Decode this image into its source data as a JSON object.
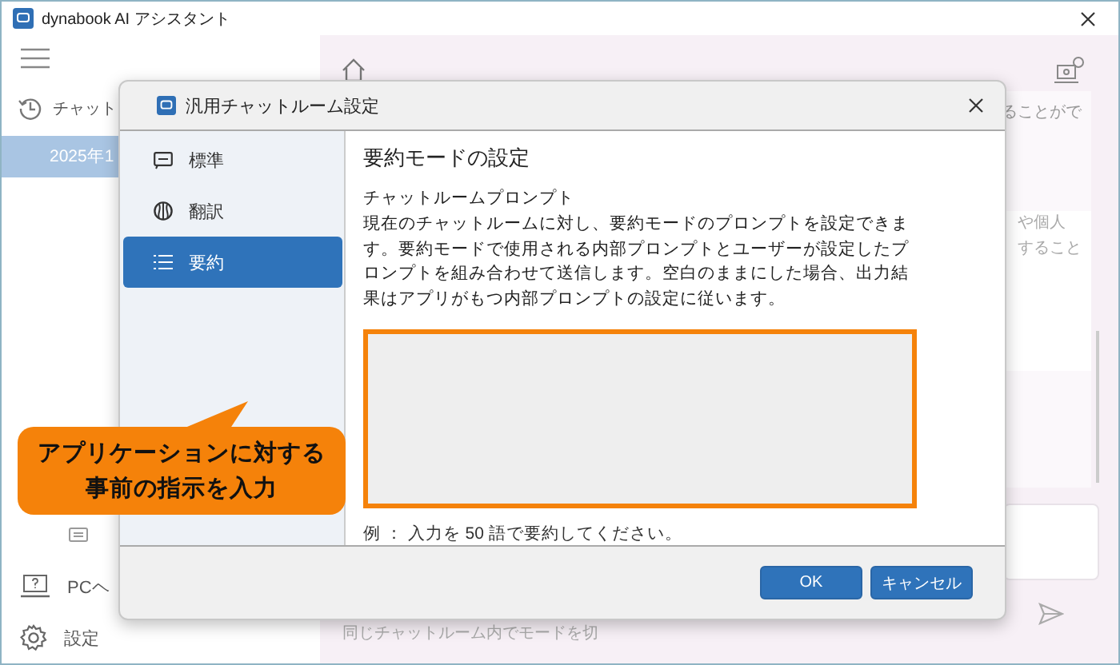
{
  "app": {
    "title": "dynabook AI アシスタント"
  },
  "sidebar": {
    "history_label": "チャット",
    "items": [
      {
        "label": "2025年1",
        "selected": true
      }
    ],
    "footer_items": [
      {
        "label": "PCヘ",
        "kind": "help"
      },
      {
        "label": "設定",
        "kind": "settings"
      }
    ]
  },
  "main": {
    "panel_text": "ることがで",
    "card_lines": [
      "や個人",
      "すること"
    ],
    "hint": "同じチャットルーム内でモードを切"
  },
  "dialog": {
    "title": "汎用チャットルーム設定",
    "nav": [
      {
        "label": "標準",
        "kind": "chat",
        "selected": false
      },
      {
        "label": "翻訳",
        "kind": "translate",
        "selected": false
      },
      {
        "label": "要約",
        "kind": "list",
        "selected": true
      }
    ],
    "heading": "要約モードの設定",
    "field_label": "チャットルームプロンプト",
    "description": "現在のチャットルームに対し、要約モードのプロンプトを設定できます。要約モードで使用される内部プロンプトとユーザーが設定したプロンプトを組み合わせて送信します。空白のままにした場合、出力結果はアプリがもつ内部プロンプトの設定に従います。",
    "example": "例 ： 入力を 50 語で要約してください。",
    "buttons": [
      "OK",
      "キャンセル"
    ]
  },
  "callout": {
    "lines": [
      "アプリケーションに対する",
      "事前の指示を入力"
    ]
  }
}
